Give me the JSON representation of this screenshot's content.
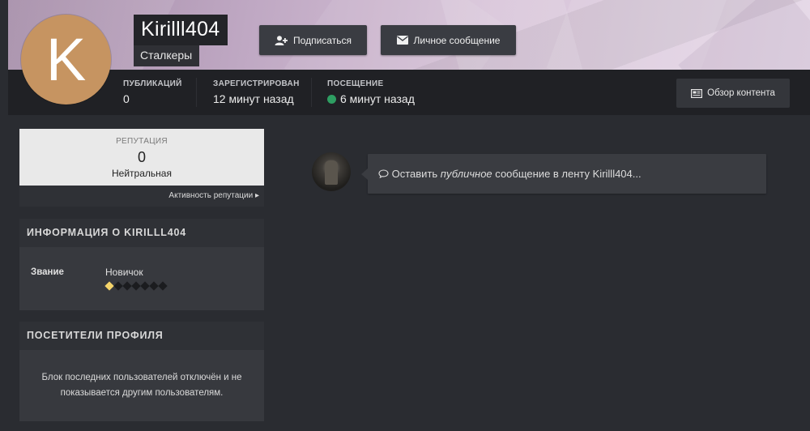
{
  "profile": {
    "username": "Kirilll404",
    "group": "Сталкеры",
    "avatar_letter": "K",
    "avatar_color": "#c69461"
  },
  "actions": {
    "follow_label": "Подписаться",
    "follow_icon": "user-plus-icon",
    "message_label": "Личное сообщение",
    "message_icon": "envelope-icon",
    "content_label": "Обзор контента",
    "content_icon": "newspaper-icon"
  },
  "stats": {
    "posts_label": "ПУБЛИКАЦИЙ",
    "posts_value": "0",
    "joined_label": "ЗАРЕГИСТРИРОВАН",
    "joined_value": "12 минут назад",
    "visit_label": "ПОСЕЩЕНИЕ",
    "visit_value": "6 минут назад",
    "online_color": "#2e9e62"
  },
  "reputation": {
    "label": "РЕПУТАЦИЯ",
    "value": "0",
    "text": "Нейтральная",
    "activity_link": "Активность репутации"
  },
  "info": {
    "title": "ИНФОРМАЦИЯ О KIRILLL404",
    "rank_key": "Звание",
    "rank_value": "Новичок",
    "rank_pips_total": 7,
    "rank_pips_filled": 1
  },
  "visitors": {
    "title": "ПОСЕТИТЕЛИ ПРОФИЛЯ",
    "message": "Блок последних пользователей отключён и не показывается другим пользователям."
  },
  "status": {
    "prefix": "Оставить",
    "emphasis": "публичное",
    "suffix": "сообщение в ленту Kirilll404...",
    "icon": "comment-icon"
  }
}
